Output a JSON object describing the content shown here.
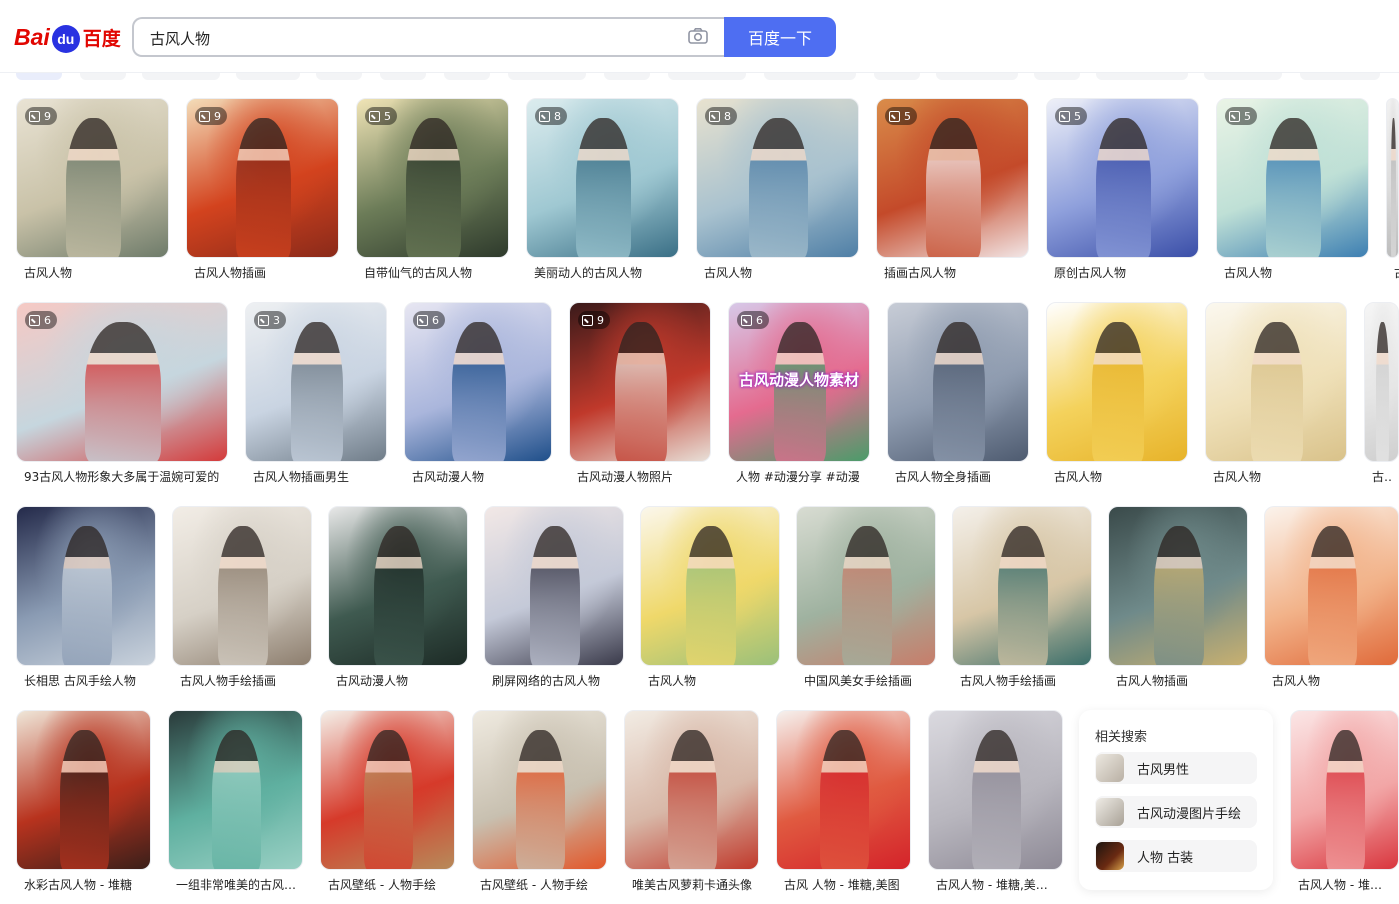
{
  "header": {
    "logo": {
      "latin": "Bai",
      "badge": "du",
      "cn": "百度"
    },
    "search_value": "古风人物",
    "search_button": "百度一下"
  },
  "colors": {
    "brand_red": "#e10601",
    "brand_blue": "#2932e1",
    "search_button": "#4e6ef2"
  },
  "results": [
    {
      "caption": "古风人物",
      "count": "9"
    },
    {
      "caption": "古风人物插画",
      "count": "9"
    },
    {
      "caption": "自带仙气的古风人物",
      "count": "5"
    },
    {
      "caption": "美丽动人的古风人物",
      "count": "8"
    },
    {
      "caption": "古风人物",
      "count": "8"
    },
    {
      "caption": "插画古风人物",
      "count": "5"
    },
    {
      "caption": "原创古风人物",
      "count": "5"
    },
    {
      "caption": "古风人物",
      "count": "5"
    },
    {
      "caption": "古",
      "count": ""
    },
    {
      "caption": "93古风人物形象大多属于温婉可爱的",
      "count": "6"
    },
    {
      "caption": "古风人物插画男生",
      "count": "3"
    },
    {
      "caption": "古风动漫人物",
      "count": "6"
    },
    {
      "caption": "古风动漫人物照片",
      "count": "9"
    },
    {
      "caption": "人物 #动漫分享 #动漫",
      "count": "6",
      "overlay": "古风动漫人物素材"
    },
    {
      "caption": "古风人物全身插画",
      "count": ""
    },
    {
      "caption": "古风人物",
      "count": ""
    },
    {
      "caption": "古风人物",
      "count": ""
    },
    {
      "caption": "古风",
      "count": ""
    },
    {
      "caption": "长相思 古风手绘人物",
      "count": ""
    },
    {
      "caption": "古风人物手绘插画",
      "count": ""
    },
    {
      "caption": "古风动漫人物",
      "count": ""
    },
    {
      "caption": "刷屏网络的古风人物",
      "count": ""
    },
    {
      "caption": "古风人物",
      "count": ""
    },
    {
      "caption": "中国风美女手绘插画",
      "count": ""
    },
    {
      "caption": "古风人物手绘插画",
      "count": ""
    },
    {
      "caption": "古风人物插画",
      "count": ""
    },
    {
      "caption": "古风人物",
      "count": ""
    },
    {
      "caption": "水彩古风人物 - 堆糖",
      "count": ""
    },
    {
      "caption": "一组非常唯美的古风人物",
      "count": ""
    },
    {
      "caption": "古风壁纸 - 人物手绘",
      "count": ""
    },
    {
      "caption": "古风壁纸 - 人物手绘",
      "count": ""
    },
    {
      "caption": "唯美古风萝莉卡通头像",
      "count": ""
    },
    {
      "caption": "古风 人物 - 堆糖,美图",
      "count": ""
    },
    {
      "caption": "古风人物 - 堆糖,美图壁纸",
      "count": ""
    },
    {
      "caption": "古风人物 - 堆糖,美图壁纸",
      "count": ""
    }
  ],
  "related": {
    "title": "相关搜索",
    "items": [
      {
        "label": "古风男性"
      },
      {
        "label": "古风动漫图片手绘"
      },
      {
        "label": "人物 古装"
      }
    ]
  }
}
